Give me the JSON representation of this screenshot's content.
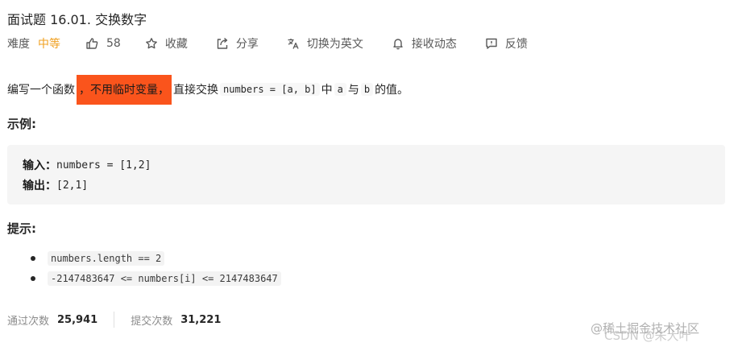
{
  "problem": {
    "title": "面试题 16.01. 交换数字"
  },
  "toolbar": {
    "difficulty_label": "难度",
    "difficulty_value": "中等",
    "likes": "58",
    "favorite": "收藏",
    "share": "分享",
    "switch_lang": "切换为英文",
    "follow": "接收动态",
    "feedback": "反馈"
  },
  "description": {
    "before": "编写一个函数",
    "highlight": "，不用临时变量，",
    "middle": "直接交换",
    "code_numbers": "numbers = [a, b]",
    "in": "中",
    "code_a": "a",
    "and": "与",
    "code_b": "b",
    "end": "的值。"
  },
  "example": {
    "section_title": "示例:",
    "input_label": "输入：",
    "input_value": "numbers = [1,2]",
    "output_label": "输出：",
    "output_value": "[2,1]"
  },
  "hints": {
    "section_title": "提示:",
    "items": [
      "numbers.length == 2",
      "-2147483647 <= numbers[i] <=  2147483647"
    ]
  },
  "stats": {
    "accepted_label": "通过次数",
    "accepted_value": "25,941",
    "submitted_label": "提交次数",
    "submitted_value": "31,221"
  },
  "watermark": {
    "line1": "@稀土掘金技术社区",
    "line2": "CSDN @朱大叶"
  },
  "colors": {
    "difficulty": "#f0a020",
    "highlight": "#fa541c"
  }
}
